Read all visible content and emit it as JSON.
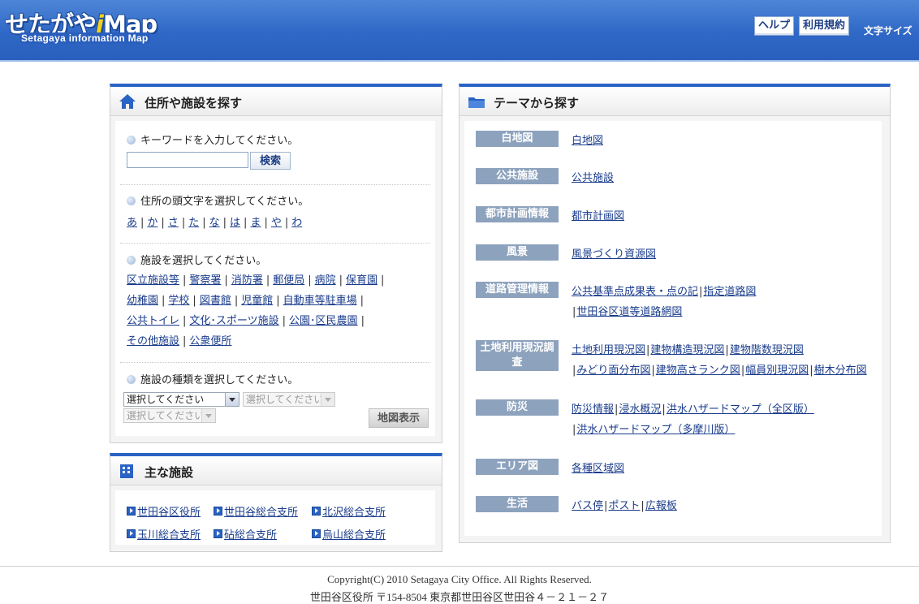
{
  "header": {
    "logo_main_prefix": "せたがや",
    "logo_main_i": "i",
    "logo_main_suffix": "Map",
    "logo_sub": "Setagaya information Map",
    "help_label": "ヘルプ",
    "terms_label": "利用規約",
    "font_size_label": "文字サイズ"
  },
  "address_panel": {
    "title": "住所や施設を探す",
    "keyword_prompt": "キーワードを入力してください。",
    "search_button": "検索",
    "initial_prompt": "住所の頭文字を選択してください。",
    "initials": [
      "あ",
      "か",
      "さ",
      "た",
      "な",
      "は",
      "ま",
      "や",
      "わ"
    ],
    "facility_prompt": "施設を選択してください。",
    "facility_rows": [
      [
        "区立施設等",
        "警察署",
        "消防署",
        "郵便局",
        "病院",
        "保育園"
      ],
      [
        "幼稚園",
        "学校",
        "図書館",
        "児童館",
        "自動車等駐車場"
      ],
      [
        "公共トイレ",
        "文化･スポーツ施設",
        "公園･区民農園"
      ],
      [
        "その他施設",
        "公衆便所"
      ]
    ],
    "type_prompt": "施設の種類を選択してください。",
    "select1": "選択してください",
    "select2": "選択してください",
    "select3": "選択してください",
    "map_button": "地図表示"
  },
  "main_facilities": {
    "title": "主な施設",
    "row1": [
      "世田谷区役所",
      "世田谷総合支所",
      "北沢総合支所"
    ],
    "row2": [
      "玉川総合支所",
      "砧総合支所",
      "烏山総合支所"
    ]
  },
  "theme_panel": {
    "title": "テーマから探す",
    "themes": [
      {
        "label": "白地図",
        "lines": [
          [
            "白地図"
          ]
        ]
      },
      {
        "label": "公共施設",
        "lines": [
          [
            "公共施設"
          ]
        ]
      },
      {
        "label": "都市計画情報",
        "lines": [
          [
            "都市計画図"
          ]
        ]
      },
      {
        "label": "風景",
        "lines": [
          [
            "風景づくり資源図"
          ]
        ]
      },
      {
        "label": "道路管理情報",
        "lines": [
          [
            "公共基準点成果表・点の記",
            "指定道路図"
          ],
          [
            "世田谷区道等道路網図"
          ]
        ]
      },
      {
        "label": "土地利用現況調査",
        "lines": [
          [
            "土地利用現況図",
            "建物構造現況図",
            "建物階数現況図"
          ],
          [
            "みどり面分布図",
            "建物高さランク図",
            "幅員別現況図",
            "樹木分布図"
          ]
        ]
      },
      {
        "label": "防災",
        "lines": [
          [
            "防災情報",
            "浸水概況",
            "洪水ハザードマップ（全区版）"
          ],
          [
            "洪水ハザードマップ（多摩川版）"
          ]
        ]
      },
      {
        "label": "エリア図",
        "lines": [
          [
            "各種区域図"
          ]
        ]
      },
      {
        "label": "生活",
        "lines": [
          [
            "バス停",
            "ポスト",
            "広報板"
          ]
        ]
      }
    ]
  },
  "footer": {
    "copyright": "Copyright(C) 2010 Setagaya City Office. All Rights Reserved.",
    "address": "世田谷区役所 〒154-8504 東京都世田谷区世田谷４－２１－２７"
  },
  "colors": {
    "header_blue": "#2f68c6",
    "panel_accent": "#2a63c4",
    "theme_label_bg": "#8da2bd",
    "link": "#1a3c8c"
  }
}
